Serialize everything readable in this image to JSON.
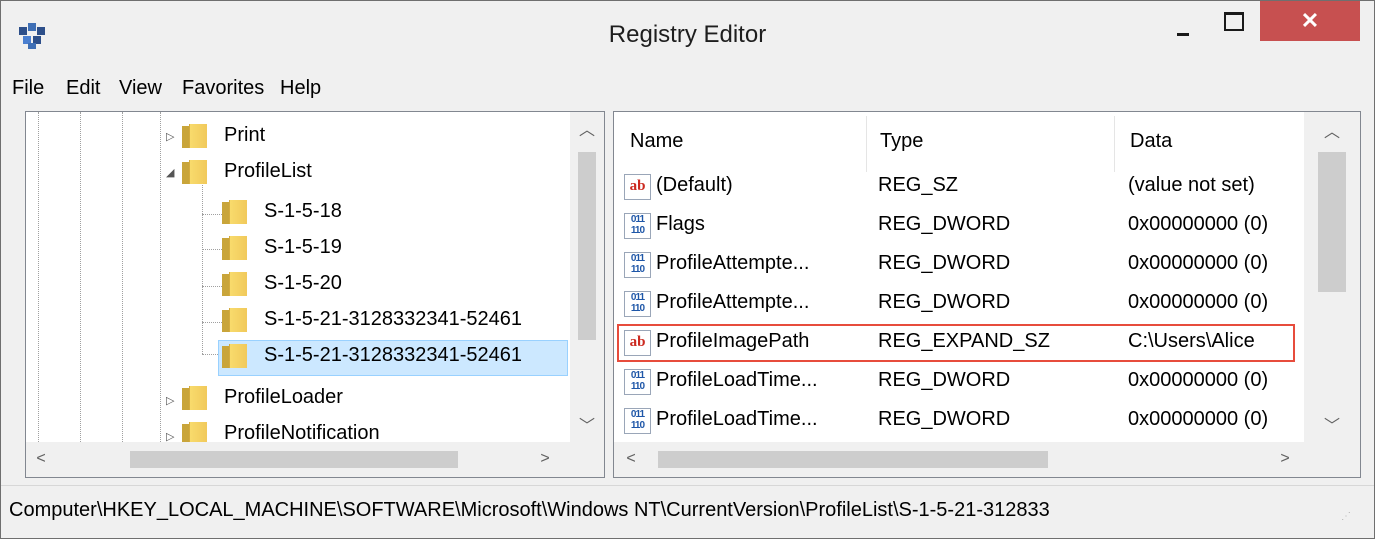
{
  "window": {
    "title": "Registry Editor",
    "icon": "registry-editor-icon",
    "close_label": "✕"
  },
  "menu": [
    "File",
    "Edit",
    "View",
    "Favorites",
    "Help"
  ],
  "tree": {
    "items": [
      {
        "label": "Print",
        "expander": "▷"
      },
      {
        "label": "ProfileList",
        "expander": "◢"
      },
      {
        "label": "S-1-5-18"
      },
      {
        "label": "S-1-5-19"
      },
      {
        "label": "S-1-5-20"
      },
      {
        "label": "S-1-5-21-3128332341-52461"
      },
      {
        "label": "S-1-5-21-3128332341-52461",
        "selected": true
      },
      {
        "label": "ProfileLoader",
        "expander": "▷"
      },
      {
        "label": "ProfileNotification",
        "expander": "▷"
      }
    ]
  },
  "list": {
    "columns": {
      "name": "Name",
      "type": "Type",
      "data": "Data"
    },
    "rows": [
      {
        "icon": "ab",
        "name": "(Default)",
        "type": "REG_SZ",
        "data": "(value not set)"
      },
      {
        "icon": "bin",
        "name": "Flags",
        "type": "REG_DWORD",
        "data": "0x00000000 (0)"
      },
      {
        "icon": "bin",
        "name": "ProfileAttempte...",
        "type": "REG_DWORD",
        "data": "0x00000000 (0)"
      },
      {
        "icon": "bin",
        "name": "ProfileAttempte...",
        "type": "REG_DWORD",
        "data": "0x00000000 (0)"
      },
      {
        "icon": "ab",
        "name": "ProfileImagePath",
        "type": "REG_EXPAND_SZ",
        "data": "C:\\Users\\Alice",
        "highlighted": true
      },
      {
        "icon": "bin",
        "name": "ProfileLoadTime...",
        "type": "REG_DWORD",
        "data": "0x00000000 (0)"
      },
      {
        "icon": "bin",
        "name": "ProfileLoadTime...",
        "type": "REG_DWORD",
        "data": "0x00000000 (0)"
      }
    ]
  },
  "icons": {
    "ab": "ab",
    "bin": "011\n110"
  },
  "statusbar": {
    "path": "Computer\\HKEY_LOCAL_MACHINE\\SOFTWARE\\Microsoft\\Windows NT\\CurrentVersion\\ProfileList\\S-1-5-21-312833"
  },
  "colors": {
    "highlight": "#e74c3c",
    "selection": "#cce8ff",
    "close_button": "#c75050"
  }
}
